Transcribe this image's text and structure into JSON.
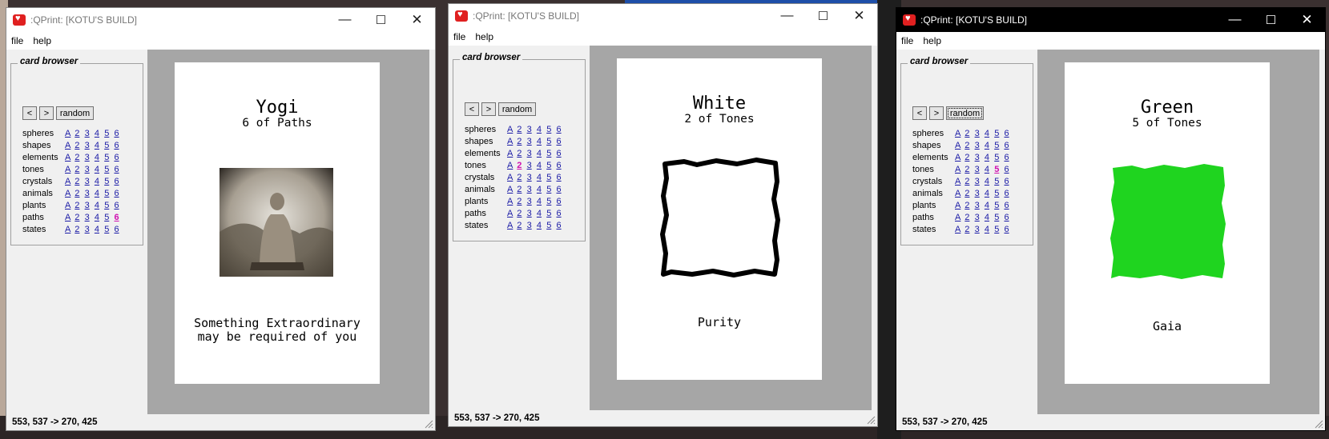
{
  "windows": [
    {
      "title": ":QPrint:  [KOTU'S BUILD]",
      "active": false,
      "menu": [
        "file",
        "help"
      ],
      "browser": {
        "legend": "card browser",
        "prev": "<",
        "next": ">",
        "random": "random",
        "random_focused": false,
        "rows": [
          {
            "label": "spheres",
            "links": [
              "A",
              "2",
              "3",
              "4",
              "5",
              "6"
            ],
            "selected": -1
          },
          {
            "label": "shapes",
            "links": [
              "A",
              "2",
              "3",
              "4",
              "5",
              "6"
            ],
            "selected": -1
          },
          {
            "label": "elements",
            "links": [
              "A",
              "2",
              "3",
              "4",
              "5",
              "6"
            ],
            "selected": -1
          },
          {
            "label": "tones",
            "links": [
              "A",
              "2",
              "3",
              "4",
              "5",
              "6"
            ],
            "selected": -1
          },
          {
            "label": "crystals",
            "links": [
              "A",
              "2",
              "3",
              "4",
              "5",
              "6"
            ],
            "selected": -1
          },
          {
            "label": "animals",
            "links": [
              "A",
              "2",
              "3",
              "4",
              "5",
              "6"
            ],
            "selected": -1
          },
          {
            "label": "plants",
            "links": [
              "A",
              "2",
              "3",
              "4",
              "5",
              "6"
            ],
            "selected": -1
          },
          {
            "label": "paths",
            "links": [
              "A",
              "2",
              "3",
              "4",
              "5",
              "6"
            ],
            "selected": 5
          },
          {
            "label": "states",
            "links": [
              "A",
              "2",
              "3",
              "4",
              "5",
              "6"
            ],
            "selected": -1
          }
        ]
      },
      "card": {
        "name": "Yogi",
        "subtitle": "6 of Paths",
        "caption": [
          "Something Extraordinary",
          "may be required of you"
        ],
        "image": "buddha-photo"
      },
      "status": "553, 537 -> 270, 425"
    },
    {
      "title": ":QPrint:  [KOTU'S BUILD]",
      "active": false,
      "menu": [
        "file",
        "help"
      ],
      "browser": {
        "legend": "card browser",
        "prev": "<",
        "next": ">",
        "random": "random",
        "random_focused": false,
        "rows": [
          {
            "label": "spheres",
            "links": [
              "A",
              "2",
              "3",
              "4",
              "5",
              "6"
            ],
            "selected": -1
          },
          {
            "label": "shapes",
            "links": [
              "A",
              "2",
              "3",
              "4",
              "5",
              "6"
            ],
            "selected": -1
          },
          {
            "label": "elements",
            "links": [
              "A",
              "2",
              "3",
              "4",
              "5",
              "6"
            ],
            "selected": -1
          },
          {
            "label": "tones",
            "links": [
              "A",
              "2",
              "3",
              "4",
              "5",
              "6"
            ],
            "selected": 1
          },
          {
            "label": "crystals",
            "links": [
              "A",
              "2",
              "3",
              "4",
              "5",
              "6"
            ],
            "selected": -1
          },
          {
            "label": "animals",
            "links": [
              "A",
              "2",
              "3",
              "4",
              "5",
              "6"
            ],
            "selected": -1
          },
          {
            "label": "plants",
            "links": [
              "A",
              "2",
              "3",
              "4",
              "5",
              "6"
            ],
            "selected": -1
          },
          {
            "label": "paths",
            "links": [
              "A",
              "2",
              "3",
              "4",
              "5",
              "6"
            ],
            "selected": -1
          },
          {
            "label": "states",
            "links": [
              "A",
              "2",
              "3",
              "4",
              "5",
              "6"
            ],
            "selected": -1
          }
        ]
      },
      "card": {
        "name": "White",
        "subtitle": "2 of Tones",
        "caption": [
          "Purity"
        ],
        "image": "white-swatch",
        "swatch_color": "#ffffff"
      },
      "status": "553, 537 -> 270, 425"
    },
    {
      "title": ":QPrint:  [KOTU'S BUILD]",
      "active": true,
      "menu": [
        "file",
        "help"
      ],
      "browser": {
        "legend": "card browser",
        "prev": "<",
        "next": ">",
        "random": "random",
        "random_focused": true,
        "rows": [
          {
            "label": "spheres",
            "links": [
              "A",
              "2",
              "3",
              "4",
              "5",
              "6"
            ],
            "selected": -1
          },
          {
            "label": "shapes",
            "links": [
              "A",
              "2",
              "3",
              "4",
              "5",
              "6"
            ],
            "selected": -1
          },
          {
            "label": "elements",
            "links": [
              "A",
              "2",
              "3",
              "4",
              "5",
              "6"
            ],
            "selected": -1
          },
          {
            "label": "tones",
            "links": [
              "A",
              "2",
              "3",
              "4",
              "5",
              "6"
            ],
            "selected": 4
          },
          {
            "label": "crystals",
            "links": [
              "A",
              "2",
              "3",
              "4",
              "5",
              "6"
            ],
            "selected": -1
          },
          {
            "label": "animals",
            "links": [
              "A",
              "2",
              "3",
              "4",
              "5",
              "6"
            ],
            "selected": -1
          },
          {
            "label": "plants",
            "links": [
              "A",
              "2",
              "3",
              "4",
              "5",
              "6"
            ],
            "selected": -1
          },
          {
            "label": "paths",
            "links": [
              "A",
              "2",
              "3",
              "4",
              "5",
              "6"
            ],
            "selected": -1
          },
          {
            "label": "states",
            "links": [
              "A",
              "2",
              "3",
              "4",
              "5",
              "6"
            ],
            "selected": -1
          }
        ]
      },
      "card": {
        "name": "Green",
        "subtitle": "5 of Tones",
        "caption": [
          "Gaia"
        ],
        "image": "green-swatch",
        "swatch_color": "#1fd41f"
      },
      "status": "553, 537 -> 270, 425"
    }
  ],
  "colors": {
    "link": "#1a1aa6",
    "link_selected": "#d010b0",
    "canvas": "#a6a6a6"
  }
}
